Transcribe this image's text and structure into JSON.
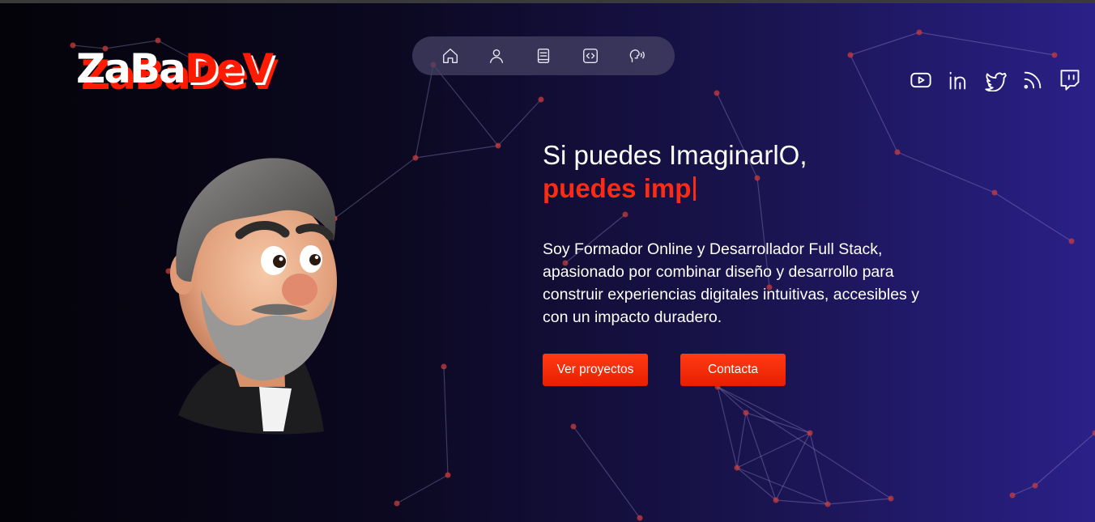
{
  "brand": {
    "logo_text_white": "ZaBa",
    "logo_text_red": "DeV",
    "accent_color": "#ff1a00"
  },
  "nav": {
    "items": [
      {
        "name": "home",
        "icon": "home-icon"
      },
      {
        "name": "about",
        "icon": "user-icon"
      },
      {
        "name": "resume",
        "icon": "book-icon"
      },
      {
        "name": "projects",
        "icon": "code-icon"
      },
      {
        "name": "contact",
        "icon": "speech-icon"
      }
    ]
  },
  "social": [
    {
      "name": "youtube",
      "icon": "youtube-icon"
    },
    {
      "name": "linkedin",
      "icon": "linkedin-icon"
    },
    {
      "name": "twitter",
      "icon": "twitter-icon"
    },
    {
      "name": "rss",
      "icon": "rss-icon"
    },
    {
      "name": "twitch",
      "icon": "twitch-icon"
    }
  ],
  "hero": {
    "headline_line1": "Si puedes ImaginarlO,",
    "headline_line2": "puedes imp",
    "bio": "Soy Formador Online y Desarrollador Full Stack, apasionado por combinar diseño y desarrollo para construir experiencias digitales intuitivas, accesibles y con un impacto duradero.",
    "primary_button": "Ver proyectos",
    "secondary_button": "Contacta"
  }
}
